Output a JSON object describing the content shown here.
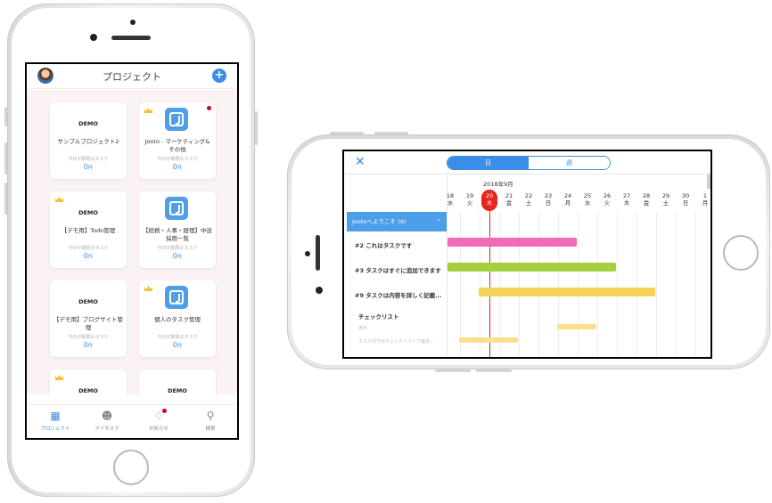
{
  "colors": {
    "accent": "#3a8ee6",
    "pink_bar": "#f06ab6",
    "green_bar": "#a6cf3f",
    "yellow_bar": "#f5d357",
    "light_yellow_bar": "#f8e08e",
    "today_red": "#e8251c"
  },
  "portrait": {
    "header": {
      "title": "プロジェクト",
      "add_icon": "plus-circle-icon"
    },
    "projects": [
      {
        "kind": "demo",
        "demo_label": "DEMO",
        "name": "サンプルプロジェクト2",
        "subtitle": "今日が期限のタスク",
        "count": "0",
        "unit": "件",
        "crown": false,
        "dot": false
      },
      {
        "kind": "logo",
        "demo_label": "",
        "name": "Jooto - マーケティング&その他",
        "subtitle": "今日が期限のタスク",
        "count": "0",
        "unit": "件",
        "crown": true,
        "dot": true
      },
      {
        "kind": "demo",
        "demo_label": "DEMO",
        "name": "【デモ用】Todo管理",
        "subtitle": "今日が期限のタスク",
        "count": "0",
        "unit": "件",
        "crown": true,
        "dot": false
      },
      {
        "kind": "logo",
        "demo_label": "",
        "name": "【総務・人事・経理】中途採用一覧",
        "subtitle": "今日が期限のタスク",
        "count": "0",
        "unit": "件",
        "crown": false,
        "dot": false
      },
      {
        "kind": "demo",
        "demo_label": "DEMO",
        "name": "【デモ用】ブログサイト管理",
        "subtitle": "今日が期限のタスク",
        "count": "0",
        "unit": "件",
        "crown": false,
        "dot": false
      },
      {
        "kind": "logo",
        "demo_label": "",
        "name": "個人のタスク管理",
        "subtitle": "今日が期限のタスク",
        "count": "0",
        "unit": "件",
        "crown": true,
        "dot": false
      },
      {
        "kind": "demo",
        "demo_label": "DEMO",
        "name": "",
        "subtitle": "",
        "count": "",
        "unit": "",
        "crown": true,
        "dot": false
      },
      {
        "kind": "demo",
        "demo_label": "DEMO",
        "name": "",
        "subtitle": "",
        "count": "",
        "unit": "",
        "crown": false,
        "dot": false
      }
    ],
    "tabs": [
      {
        "label": "プロジェクト",
        "icon": "grid-icon",
        "active": true
      },
      {
        "label": "マイタスク",
        "icon": "user-check-icon",
        "active": false
      },
      {
        "label": "お知らせ",
        "icon": "bell-icon",
        "active": false
      },
      {
        "label": "検索",
        "icon": "search-icon",
        "active": false
      }
    ]
  },
  "gantt": {
    "close_icon": "close-icon",
    "segment": {
      "day": "日",
      "week": "週"
    },
    "month": "2018年9月",
    "days": [
      {
        "d": "18",
        "w": "水"
      },
      {
        "d": "19",
        "w": "火"
      },
      {
        "d": "20",
        "w": "木"
      },
      {
        "d": "21",
        "w": "金"
      },
      {
        "d": "22",
        "w": "土"
      },
      {
        "d": "23",
        "w": "日"
      },
      {
        "d": "24",
        "w": "月"
      },
      {
        "d": "25",
        "w": "水"
      },
      {
        "d": "26",
        "w": "火"
      },
      {
        "d": "27",
        "w": "木"
      },
      {
        "d": "28",
        "w": "金"
      },
      {
        "d": "29",
        "w": "土"
      },
      {
        "d": "30",
        "w": "日"
      },
      {
        "d": "1",
        "w": "月"
      }
    ],
    "today_index": 2,
    "group": "Jootoへようこそ (4)",
    "tasks": [
      {
        "label": "#2 これはタスクです",
        "style": "bold"
      },
      {
        "label": "#3 タスクはすぐに追加できます",
        "style": "bold"
      },
      {
        "label": "#9 タスクは内容を詳しく記載...",
        "style": "bold"
      },
      {
        "label": "チェックリスト",
        "style": "bold"
      },
      {
        "label": "表示",
        "style": "light"
      },
      {
        "label": "タスク内ではチェックリストで進捗...",
        "style": "light"
      }
    ],
    "bars": [
      {
        "task": 0,
        "start": 0,
        "end": 6.6,
        "color": "pink_bar"
      },
      {
        "task": 1,
        "start": 0,
        "end": 8.6,
        "color": "green_bar"
      },
      {
        "task": 2,
        "start": 1.6,
        "end": 10.6,
        "color": "yellow_bar"
      },
      {
        "task": 4,
        "start": 5.6,
        "end": 7.6,
        "color": "light_yellow_bar"
      },
      {
        "task": 5,
        "start": 0.6,
        "end": 3.6,
        "color": "light_yellow_bar"
      }
    ]
  }
}
